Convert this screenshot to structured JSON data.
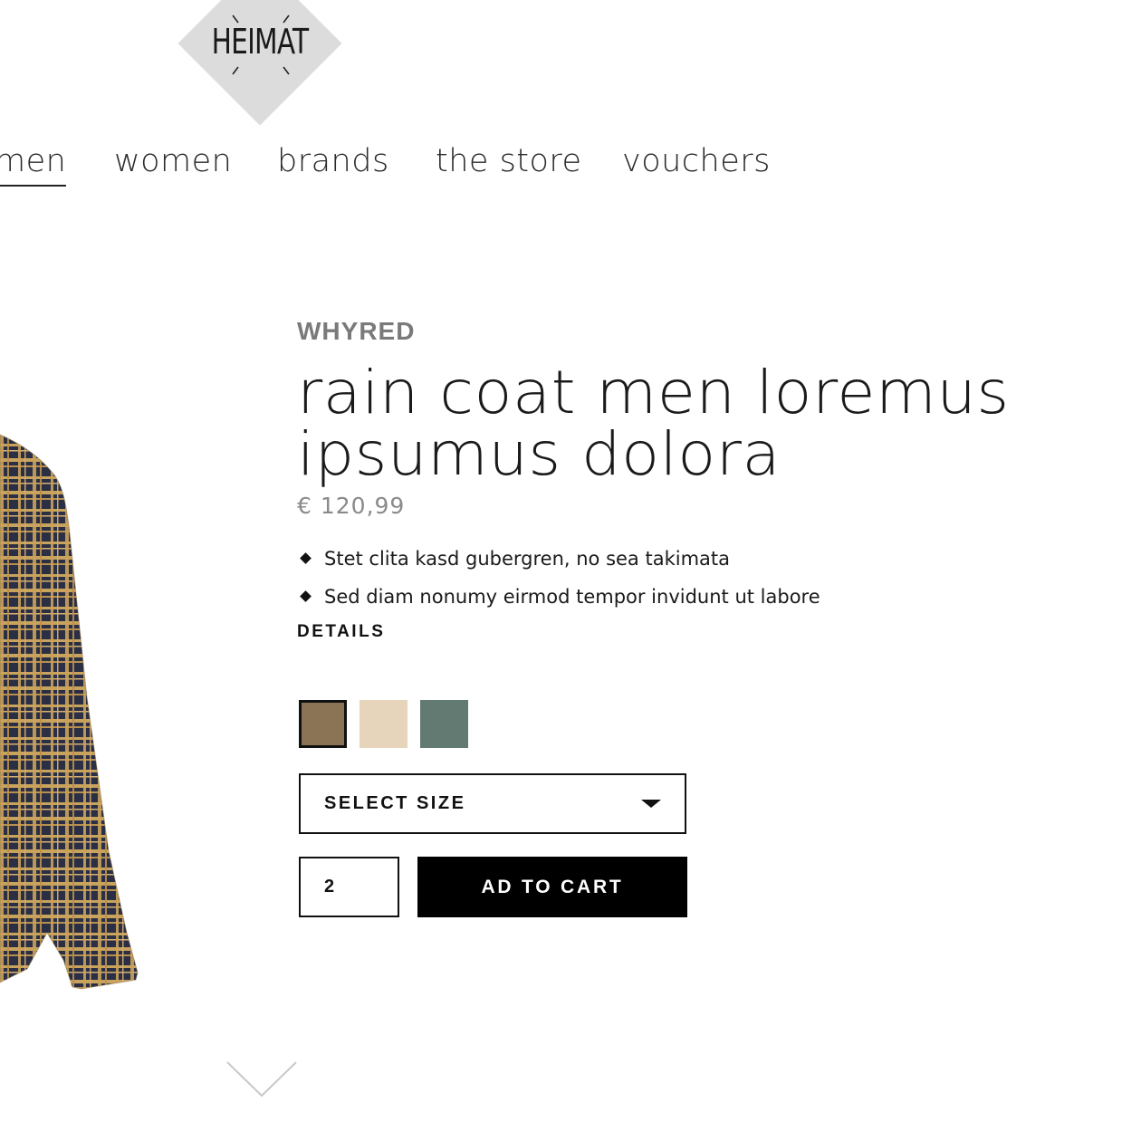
{
  "logo": {
    "text": "HEIMAT",
    "icon": "heimat-diamond-logo"
  },
  "nav": {
    "items": [
      {
        "label": "men",
        "active": true
      },
      {
        "label": "women",
        "active": false
      },
      {
        "label": "brands",
        "active": false
      },
      {
        "label": "the store",
        "active": false
      },
      {
        "label": "vouchers",
        "active": false
      }
    ]
  },
  "product": {
    "brand": "WHYRED",
    "title_line1": "rain coat men loremus",
    "title_line2": "ipsumus dolora",
    "price": "€ 120,99",
    "features": [
      "Stet clita kasd gubergren, no sea takimata",
      "Sed diam nonumy eirmod tempor invidunt ut labore"
    ],
    "details_label": "DETAILS",
    "image_icon": "plaid-shirt-image",
    "swatches": [
      {
        "color": "#8b7355",
        "selected": true
      },
      {
        "color": "#e6d5bb",
        "selected": false
      },
      {
        "color": "#637a72",
        "selected": false
      }
    ]
  },
  "purchase": {
    "select_size_label": "SELECT SIZE",
    "quantity": "2",
    "add_to_cart_label": "AD TO CART"
  },
  "scroll": {
    "icon": "chevron-down-icon"
  }
}
